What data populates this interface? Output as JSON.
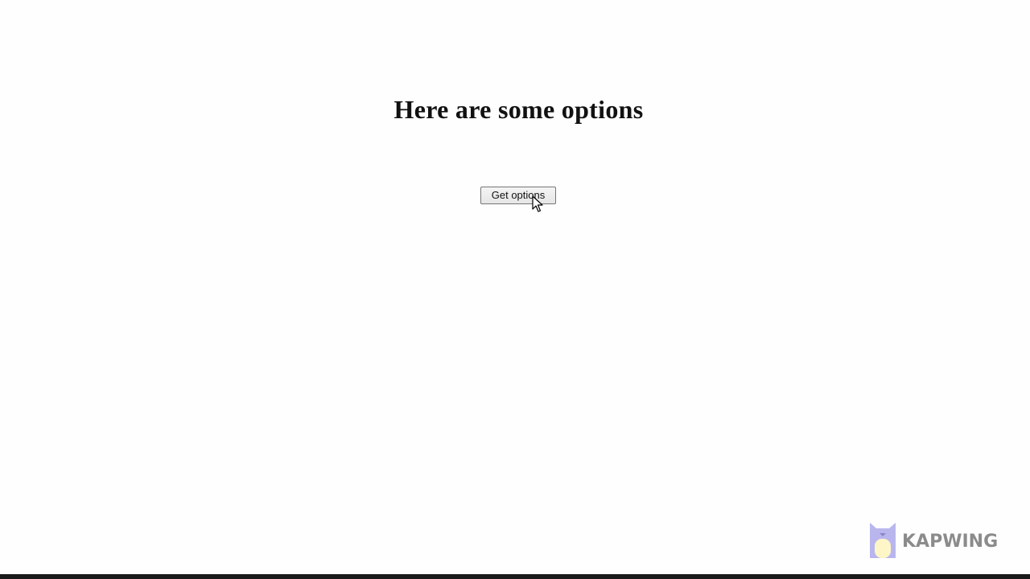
{
  "page": {
    "title": "Here are some options",
    "button_label": "Get options"
  },
  "watermark": {
    "text": "KAPWING",
    "icon": "kapwing-cat-logo-icon",
    "color": "#777777",
    "icon_colors": [
      "#b9b6ee",
      "#fff6c8"
    ]
  },
  "cursor": {
    "icon": "arrow-cursor-icon"
  }
}
